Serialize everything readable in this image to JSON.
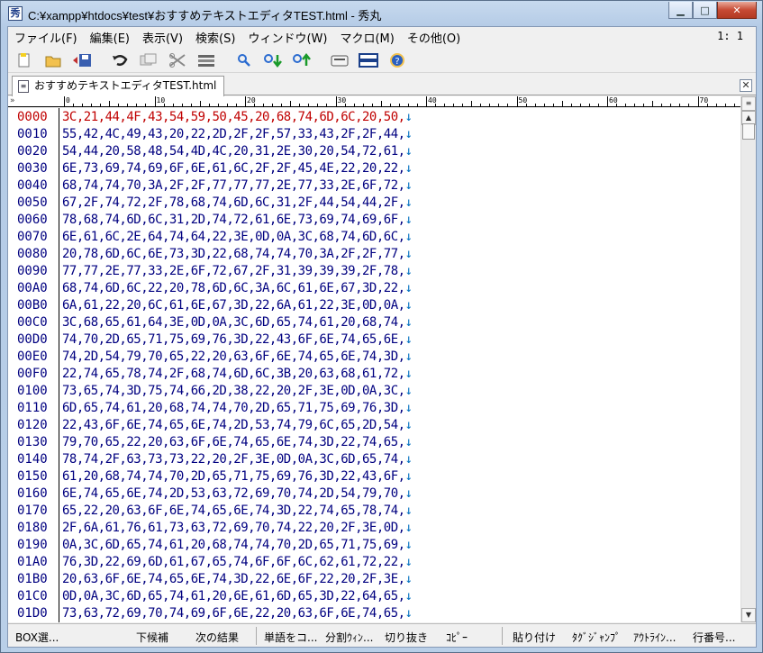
{
  "window": {
    "title": "C:¥xampp¥htdocs¥test¥おすすめテキストエディタTEST.html  - 秀丸",
    "icon": "hidemaru-app-icon"
  },
  "menu": {
    "items": [
      "ファイル(F)",
      "編集(E)",
      "表示(V)",
      "検索(S)",
      "ウィンドウ(W)",
      "マクロ(M)",
      "その他(O)"
    ],
    "position": "1: 1"
  },
  "toolbar": {
    "buttons": [
      "new-file-icon",
      "open-folder-icon",
      "save-icon",
      "undo-icon",
      "copy-icon",
      "cut-icon",
      "paste-icon",
      "find-icon",
      "find-down-icon",
      "find-up-icon",
      "keyboard-icon",
      "split-window-icon",
      "help-icon"
    ]
  },
  "tab": {
    "label": "おすすめテキストエディタTEST.html"
  },
  "ruler": {
    "marks": [
      "0",
      "10",
      "20",
      "30",
      "40",
      "50",
      "60",
      "70"
    ],
    "corner": "»"
  },
  "lines": [
    {
      "num": "0000",
      "text": "3C,21,44,4F,43,54,59,50,45,20,68,74,6D,6C,20,50,"
    },
    {
      "num": "0010",
      "text": "55,42,4C,49,43,20,22,2D,2F,2F,57,33,43,2F,2F,44,"
    },
    {
      "num": "0020",
      "text": "54,44,20,58,48,54,4D,4C,20,31,2E,30,20,54,72,61,"
    },
    {
      "num": "0030",
      "text": "6E,73,69,74,69,6F,6E,61,6C,2F,2F,45,4E,22,20,22,"
    },
    {
      "num": "0040",
      "text": "68,74,74,70,3A,2F,2F,77,77,77,2E,77,33,2E,6F,72,"
    },
    {
      "num": "0050",
      "text": "67,2F,74,72,2F,78,68,74,6D,6C,31,2F,44,54,44,2F,"
    },
    {
      "num": "0060",
      "text": "78,68,74,6D,6C,31,2D,74,72,61,6E,73,69,74,69,6F,"
    },
    {
      "num": "0070",
      "text": "6E,61,6C,2E,64,74,64,22,3E,0D,0A,3C,68,74,6D,6C,"
    },
    {
      "num": "0080",
      "text": "20,78,6D,6C,6E,73,3D,22,68,74,74,70,3A,2F,2F,77,"
    },
    {
      "num": "0090",
      "text": "77,77,2E,77,33,2E,6F,72,67,2F,31,39,39,39,2F,78,"
    },
    {
      "num": "00A0",
      "text": "68,74,6D,6C,22,20,78,6D,6C,3A,6C,61,6E,67,3D,22,"
    },
    {
      "num": "00B0",
      "text": "6A,61,22,20,6C,61,6E,67,3D,22,6A,61,22,3E,0D,0A,"
    },
    {
      "num": "00C0",
      "text": "3C,68,65,61,64,3E,0D,0A,3C,6D,65,74,61,20,68,74,"
    },
    {
      "num": "00D0",
      "text": "74,70,2D,65,71,75,69,76,3D,22,43,6F,6E,74,65,6E,"
    },
    {
      "num": "00E0",
      "text": "74,2D,54,79,70,65,22,20,63,6F,6E,74,65,6E,74,3D,"
    },
    {
      "num": "00F0",
      "text": "22,74,65,78,74,2F,68,74,6D,6C,3B,20,63,68,61,72,"
    },
    {
      "num": "0100",
      "text": "73,65,74,3D,75,74,66,2D,38,22,20,2F,3E,0D,0A,3C,"
    },
    {
      "num": "0110",
      "text": "6D,65,74,61,20,68,74,74,70,2D,65,71,75,69,76,3D,"
    },
    {
      "num": "0120",
      "text": "22,43,6F,6E,74,65,6E,74,2D,53,74,79,6C,65,2D,54,"
    },
    {
      "num": "0130",
      "text": "79,70,65,22,20,63,6F,6E,74,65,6E,74,3D,22,74,65,"
    },
    {
      "num": "0140",
      "text": "78,74,2F,63,73,73,22,20,2F,3E,0D,0A,3C,6D,65,74,"
    },
    {
      "num": "0150",
      "text": "61,20,68,74,74,70,2D,65,71,75,69,76,3D,22,43,6F,"
    },
    {
      "num": "0160",
      "text": "6E,74,65,6E,74,2D,53,63,72,69,70,74,2D,54,79,70,"
    },
    {
      "num": "0170",
      "text": "65,22,20,63,6F,6E,74,65,6E,74,3D,22,74,65,78,74,"
    },
    {
      "num": "0180",
      "text": "2F,6A,61,76,61,73,63,72,69,70,74,22,20,2F,3E,0D,"
    },
    {
      "num": "0190",
      "text": "0A,3C,6D,65,74,61,20,68,74,74,70,2D,65,71,75,69,"
    },
    {
      "num": "01A0",
      "text": "76,3D,22,69,6D,61,67,65,74,6F,6F,6C,62,61,72,22,"
    },
    {
      "num": "01B0",
      "text": "20,63,6F,6E,74,65,6E,74,3D,22,6E,6F,22,20,2F,3E,"
    },
    {
      "num": "01C0",
      "text": "0D,0A,3C,6D,65,74,61,20,6E,61,6D,65,3D,22,64,65,"
    },
    {
      "num": "01D0",
      "text": "73,63,72,69,70,74,69,6F,6E,22,20,63,6F,6E,74,65,"
    }
  ],
  "linebreak": "↓",
  "status": {
    "items": [
      "BOX選...",
      "下候補",
      "次の結果",
      "単語をコ...",
      "分割ｳｨﾝ...",
      "切り抜き",
      "ｺﾋﾟｰ",
      "貼り付け",
      "ﾀｸﾞｼﾞｬﾝﾌﾟ",
      "ｱｳﾄﾗｲﾝ...",
      "行番号..."
    ]
  }
}
